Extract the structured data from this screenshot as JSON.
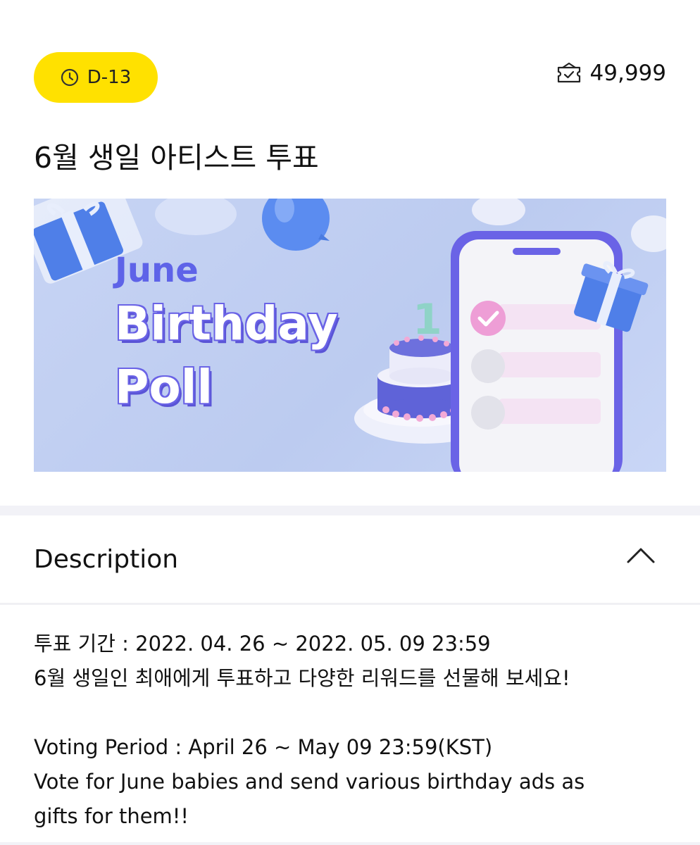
{
  "header": {
    "dday": "D-13",
    "vote_count": "49,999"
  },
  "poll": {
    "title": "6월 생일 아티스트 투표"
  },
  "banner": {
    "month": "June",
    "line1": "Birthday",
    "line2": "Poll",
    "cake_number": "1",
    "colors": {
      "background": "#C3D0F3",
      "accent": "#5E63E8",
      "phone_frame": "#6A63E6"
    }
  },
  "description": {
    "heading": "Description",
    "lines": [
      "투표 기간 : 2022. 04. 26 ~ 2022. 05. 09 23:59",
      "6월 생일인 최애에게 투표하고 다양한 리워드를 선물해 보세요!",
      "",
      "Voting Period : April 26 ~ May 09 23:59(KST)",
      "Vote for June babies and send various birthday ads as",
      "gifts for them!!"
    ]
  },
  "colors": {
    "badge_yellow": "#FFE100",
    "text": "#111111"
  }
}
